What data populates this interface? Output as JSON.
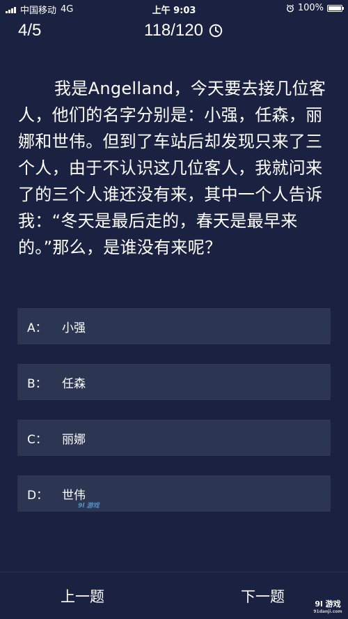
{
  "status_bar": {
    "carrier": "中国移动",
    "network": "4G",
    "time": "上午 9:03",
    "battery_percent": "100%",
    "battery_level": 1.0
  },
  "header": {
    "progress": "4/5",
    "score": "118/120",
    "timer_icon": "clock-icon"
  },
  "question": {
    "text": "我是Angelland，今天要去接几位客人，他们的名字分别是：小强，任森，丽娜和世伟。但到了车站后却发现只来了三个人，由于不认识这几位客人，我就问来了的三个人谁还没有来，其中一个人告诉我：“冬天是最后走的，春天是最早来的。”那么，是谁没有来呢？"
  },
  "options": [
    {
      "letter": "A：",
      "text": "小强"
    },
    {
      "letter": "B：",
      "text": "任森"
    },
    {
      "letter": "C：",
      "text": "丽娜"
    },
    {
      "letter": "D：",
      "text": "世伟"
    }
  ],
  "watermark": {
    "small": "9l 游戏",
    "logo_main": "9l 游戏",
    "logo_sub": "91danji.com"
  },
  "footer": {
    "prev_label": "上一题",
    "next_label": "下一题"
  },
  "colors": {
    "background": "#1b2241",
    "option_bg": "#2c3552",
    "text": "#ffffff"
  }
}
